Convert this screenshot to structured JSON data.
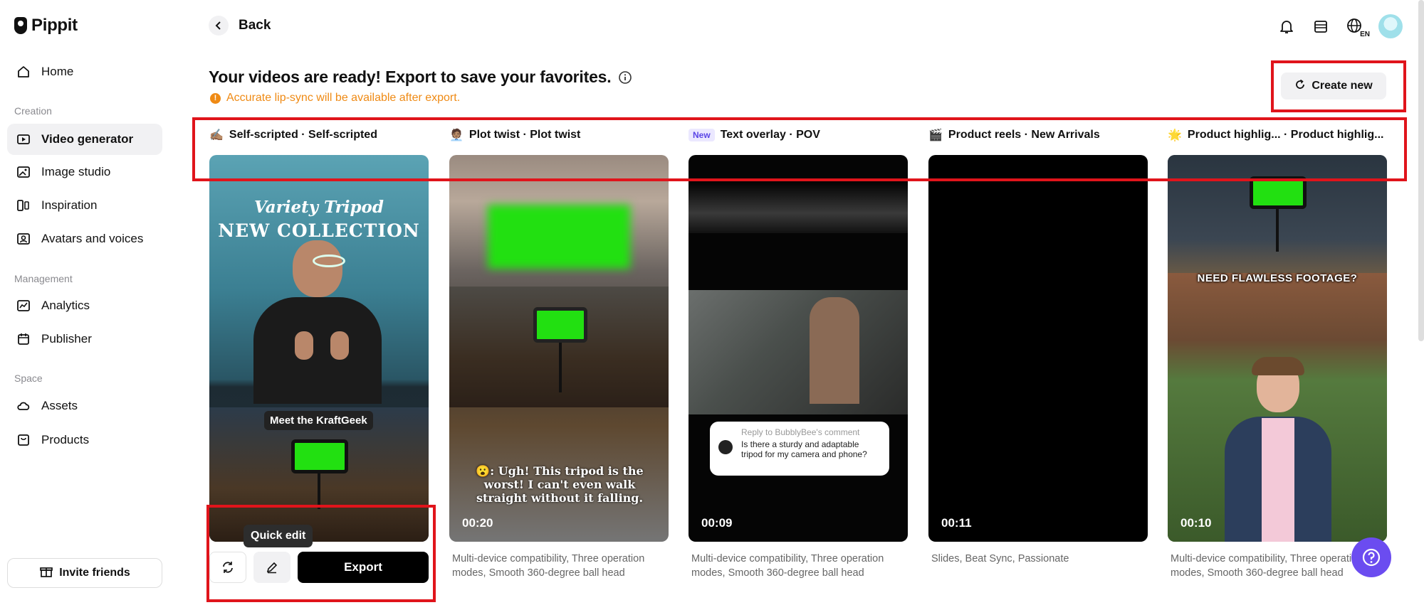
{
  "app": {
    "name": "Pippit"
  },
  "sidebar": {
    "items": [
      {
        "label": "Home",
        "icon": "home-icon"
      },
      {
        "label": "Video generator",
        "icon": "video-generator-icon",
        "active": true
      },
      {
        "label": "Image studio",
        "icon": "image-studio-icon"
      },
      {
        "label": "Inspiration",
        "icon": "inspiration-icon"
      },
      {
        "label": "Avatars and voices",
        "icon": "avatar-icon"
      },
      {
        "label": "Analytics",
        "icon": "analytics-icon"
      },
      {
        "label": "Publisher",
        "icon": "calendar-icon"
      },
      {
        "label": "Assets",
        "icon": "cloud-icon"
      },
      {
        "label": "Products",
        "icon": "products-icon"
      }
    ],
    "sections": {
      "creation": "Creation",
      "management": "Management",
      "space": "Space"
    },
    "invite_label": "Invite friends"
  },
  "topbar": {
    "back_label": "Back",
    "language": "EN"
  },
  "header": {
    "title": "Your videos are ready! Export to save your favorites.",
    "warning": "Accurate lip-sync will be available after export.",
    "create_new_label": "Create new"
  },
  "cards": [
    {
      "emoji": "✍🏽",
      "title": "Self-scripted · Self-scripted",
      "overlay_title_1": "Variety Tripod",
      "overlay_title_2": "NEW COLLECTION",
      "caption": "Meet the KraftGeek",
      "tooltip": "Quick edit",
      "export_label": "Export"
    },
    {
      "emoji": "🧑🏽‍💼",
      "title": "Plot twist · Plot twist",
      "duration": "00:20",
      "subtitle": "😮: Ugh! This tripod is the worst! I can't even walk straight without it falling.",
      "description": "Multi-device compatibility, Three operation modes, Smooth 360-degree ball head"
    },
    {
      "badge": "New",
      "title": "Text overlay · POV",
      "duration": "00:09",
      "comment_reply": "Reply to BubblyBee's comment",
      "comment_text": "Is there a sturdy and adaptable tripod for my camera and phone?",
      "description": "Multi-device compatibility, Three operation modes, Smooth 360-degree ball head"
    },
    {
      "emoji": "🎬",
      "title": "Product reels · New Arrivals",
      "duration": "00:11",
      "description": "Slides, Beat Sync, Passionate"
    },
    {
      "emoji": "🌟",
      "title": "Product highlig... · Product highlig...",
      "duration": "00:10",
      "overlay_text": "NEED FLAWLESS FOOTAGE?",
      "description": "Multi-device compatibility, Three operation modes, Smooth 360-degree ball head"
    }
  ],
  "colors": {
    "accent": "#6b4cf0",
    "warning": "#ef8a14",
    "annotation": "#e0141b",
    "green_screen": "#22e011"
  }
}
